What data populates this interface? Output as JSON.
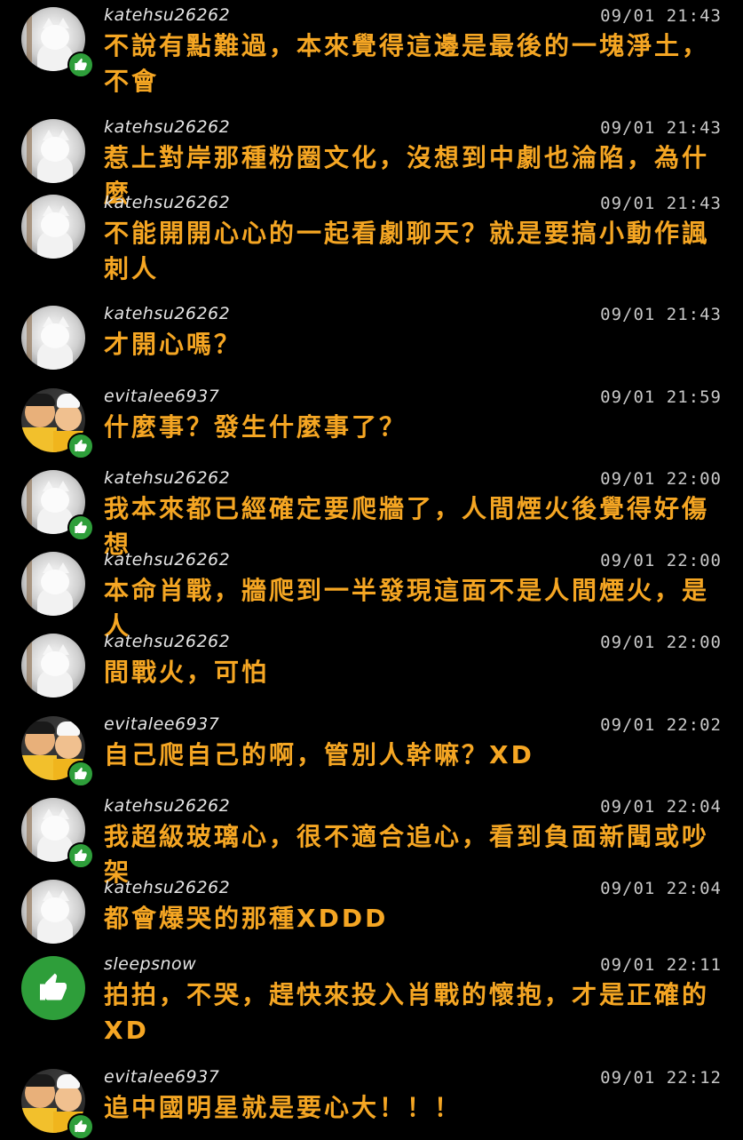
{
  "colors": {
    "background": "#000000",
    "username": "#e6e6e6",
    "timestamp": "#c8c8c8",
    "message_text": "#f5a623",
    "like_badge": "#2e9e3a"
  },
  "messages": [
    {
      "user": "katehsu26262",
      "time": "09/01 21:43",
      "text": "不說有點難過，本來覺得這邊是最後的一塊淨土，不會",
      "avatar": "cat-avatar",
      "badge": "thumbs-up-icon"
    },
    {
      "user": "katehsu26262",
      "time": "09/01 21:43",
      "text": "惹上對岸那種粉圈文化，沒想到中劇也淪陷，為什麼",
      "avatar": "cat-avatar",
      "badge": ""
    },
    {
      "user": "katehsu26262",
      "time": "09/01 21:43",
      "text": "不能開開心心的一起看劇聊天？就是要搞小動作諷刺人",
      "avatar": "cat-avatar",
      "badge": ""
    },
    {
      "user": "katehsu26262",
      "time": "09/01 21:43",
      "text": "才開心嗎？",
      "avatar": "cat-avatar",
      "badge": ""
    },
    {
      "user": "evitalee6937",
      "time": "09/01 21:59",
      "text": "什麼事？發生什麼事了？",
      "avatar": "people-avatar",
      "badge": "thumbs-up-icon"
    },
    {
      "user": "katehsu26262",
      "time": "09/01 22:00",
      "text": "我本來都已經確定要爬牆了，人間煙火後覺得好傷想",
      "avatar": "cat-avatar",
      "badge": "thumbs-up-icon"
    },
    {
      "user": "katehsu26262",
      "time": "09/01 22:00",
      "text": "本命肖戰，牆爬到一半發現這面不是人間煙火，是人",
      "avatar": "cat-avatar",
      "badge": ""
    },
    {
      "user": "katehsu26262",
      "time": "09/01 22:00",
      "text": "間戰火，可怕",
      "avatar": "cat-avatar",
      "badge": ""
    },
    {
      "user": "evitalee6937",
      "time": "09/01 22:02",
      "text": "自己爬自己的啊，管別人幹嘛？XD",
      "avatar": "people-avatar",
      "badge": "thumbs-up-icon"
    },
    {
      "user": "katehsu26262",
      "time": "09/01 22:04",
      "text": "我超級玻璃心，很不適合追心，看到負面新聞或吵架",
      "avatar": "cat-avatar",
      "badge": "thumbs-up-icon"
    },
    {
      "user": "katehsu26262",
      "time": "09/01 22:04",
      "text": "都會爆哭的那種XDDD",
      "avatar": "cat-avatar",
      "badge": ""
    },
    {
      "user": "sleepsnow",
      "time": "09/01 22:11",
      "text": "拍拍，不哭，趕快來投入肖戰的懷抱，才是正確的XD",
      "avatar": "green-like-avatar",
      "badge": ""
    },
    {
      "user": "evitalee6937",
      "time": "09/01 22:12",
      "text": "追中國明星就是要心大！！！",
      "avatar": "people-avatar",
      "badge": "thumbs-up-icon"
    }
  ]
}
